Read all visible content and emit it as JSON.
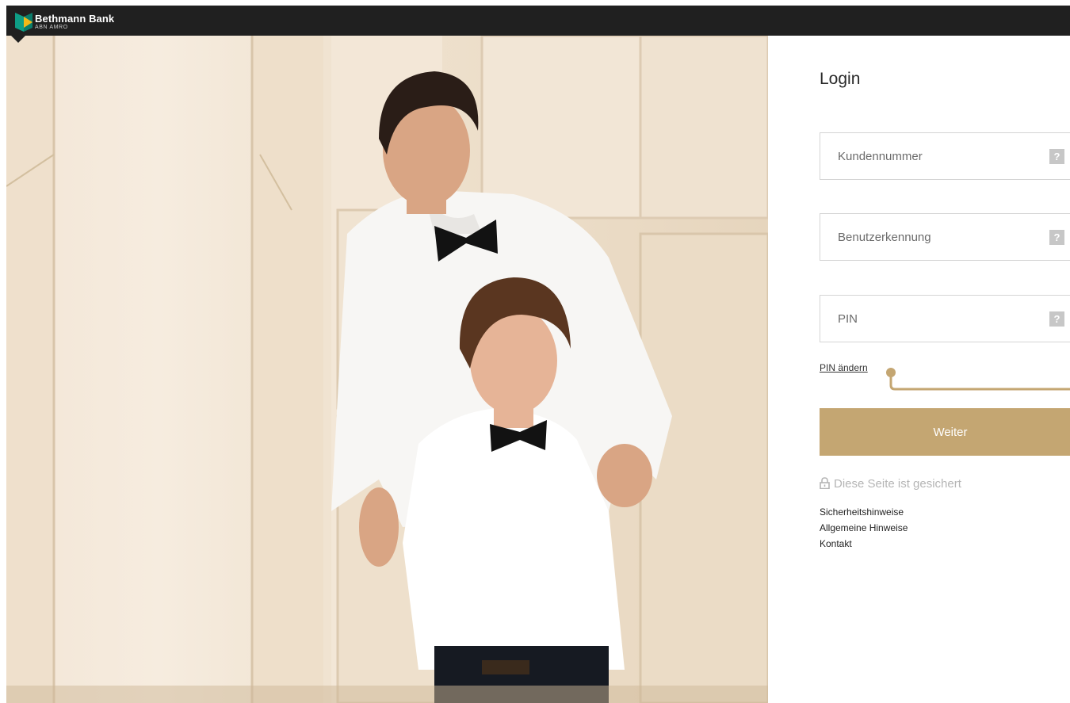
{
  "header": {
    "brand_name": "Bethmann Bank",
    "brand_sub": "ABN AMRO"
  },
  "login": {
    "title": "Login",
    "fields": [
      {
        "placeholder": "Kundennummer",
        "help": "?"
      },
      {
        "placeholder": "Benutzerkennung",
        "help": "?"
      },
      {
        "placeholder": "PIN",
        "help": "?"
      }
    ],
    "pin_change_label": "PIN ändern",
    "submit_label": "Weiter",
    "secure_label": "Diese Seite ist gesichert",
    "links": [
      "Sicherheitshinweise",
      "Allgemeine Hinweise",
      "Kontakt"
    ]
  },
  "colors": {
    "accent_gold": "#c4a672",
    "header_bg": "#202020",
    "logo_green": "#0e9e86",
    "logo_yellow": "#f2b818"
  },
  "icons": [
    "bethmann-logo-icon",
    "help-icon",
    "lock-icon"
  ]
}
